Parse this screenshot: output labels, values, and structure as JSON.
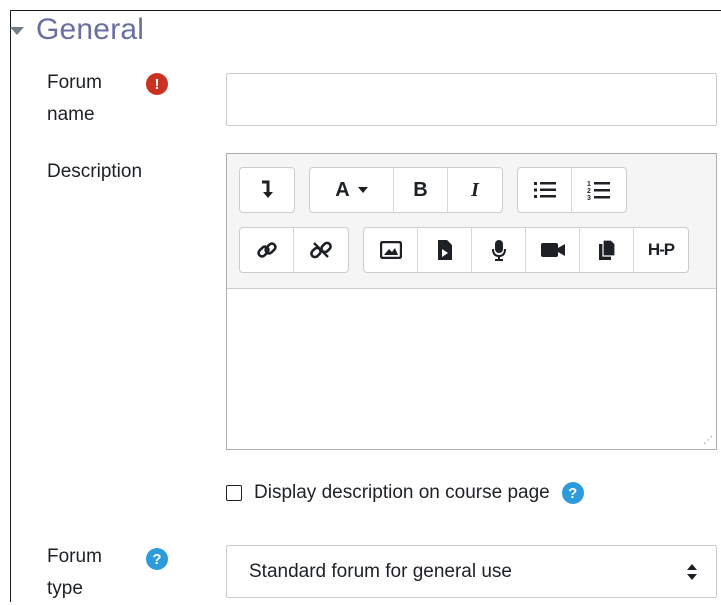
{
  "section": {
    "title": "General"
  },
  "forum_name": {
    "label_line1": "Forum",
    "label_line2": "name",
    "required_icon": "!",
    "value": ""
  },
  "description": {
    "label": "Description",
    "toolbar": {
      "row1": [
        "collapse-icon",
        "font-color-icon",
        "bold-icon",
        "italic-icon",
        "unordered-list-icon",
        "ordered-list-icon"
      ],
      "row2": [
        "link-icon",
        "unlink-icon",
        "image-icon",
        "media-icon",
        "record-audio-icon",
        "record-video-icon",
        "manage-files-icon",
        "h5p-icon"
      ],
      "font_label": "A",
      "bold_label": "B",
      "italic_label": "I",
      "h5p_label": "H-P"
    },
    "content": ""
  },
  "display_description": {
    "label": "Display description on course page",
    "checked": false,
    "help_icon": "?"
  },
  "forum_type": {
    "label_line1": "Forum",
    "label_line2": "type",
    "help_icon": "?",
    "selected": "Standard forum for general use"
  },
  "colors": {
    "title": "#6a6fa0",
    "required": "#ca3120",
    "help": "#2d9adb",
    "border": "#c9cdd1"
  }
}
